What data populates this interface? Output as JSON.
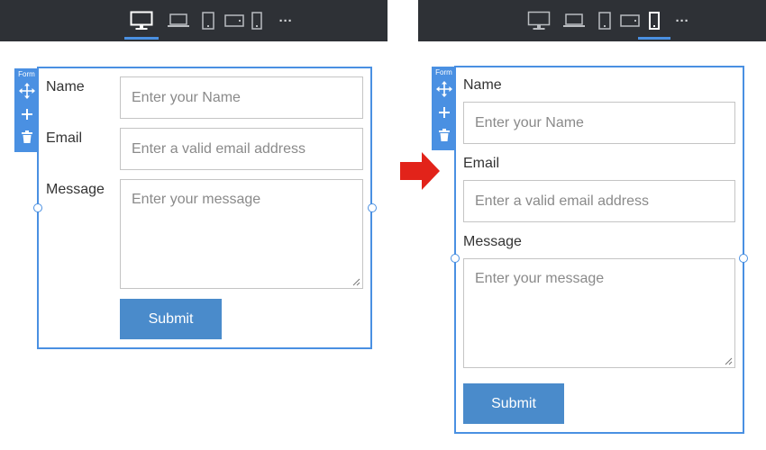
{
  "toolbar": {
    "devices": [
      "desktop",
      "laptop",
      "tablet-portrait",
      "tablet-landscape",
      "mobile"
    ],
    "more_label": "···",
    "left_active": "desktop",
    "right_active": "mobile"
  },
  "form": {
    "tag_label": "Form",
    "name_label": "Name",
    "name_placeholder": "Enter your Name",
    "email_label": "Email",
    "email_placeholder": "Enter a valid email address",
    "message_label": "Message",
    "message_placeholder": "Enter your message",
    "submit_label": "Submit"
  },
  "colors": {
    "accent": "#4a90e2",
    "highlight": "#e2231a",
    "toolbar_bg": "#2e3136",
    "button_bg": "#4a8bcb"
  }
}
